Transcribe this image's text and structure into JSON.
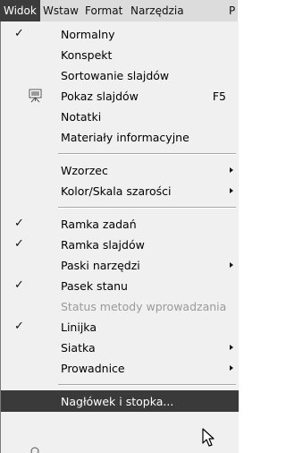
{
  "menubar": {
    "items": [
      {
        "label": "Widok",
        "active": true
      },
      {
        "label": "Wstaw"
      },
      {
        "label": "Format"
      },
      {
        "label": "Narzędzia"
      },
      {
        "label": "P"
      }
    ]
  },
  "menu": {
    "items": [
      {
        "label": "Normalny",
        "checked": true
      },
      {
        "label": "Konspekt"
      },
      {
        "label": "Sortowanie slajdów"
      },
      {
        "label": "Pokaz slajdów",
        "shortcut": "F5",
        "icon": "slideshow-icon"
      },
      {
        "label": "Notatki"
      },
      {
        "label": "Materiały informacyjne"
      },
      {
        "label": "Wzorzec",
        "submenu": true
      },
      {
        "label": "Kolor/Skala szarości",
        "submenu": true
      },
      {
        "label": "Ramka zadań",
        "checked": true
      },
      {
        "label": "Ramka slajdów",
        "checked": true
      },
      {
        "label": "Paski narzędzi",
        "submenu": true
      },
      {
        "label": "Pasek stanu",
        "checked": true
      },
      {
        "label": "Status metody wprowadzania",
        "disabled": true
      },
      {
        "label": "Linijka",
        "checked": true
      },
      {
        "label": "Siatka",
        "submenu": true
      },
      {
        "label": "Prowadnice",
        "submenu": true
      },
      {
        "label": "Nagłówek i stopka...",
        "highlighted": true
      }
    ]
  },
  "colors": {
    "menubar_bg": "#dcdcdc",
    "menu_bg": "#f0f0f0",
    "highlight_bg": "#3a3a3a",
    "disabled_text": "#9a9a9a"
  }
}
